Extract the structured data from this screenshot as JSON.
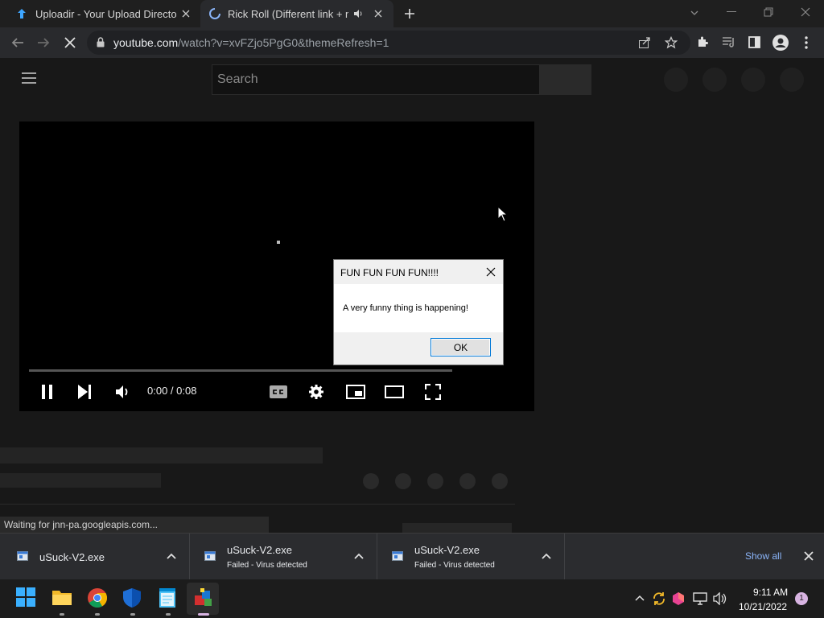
{
  "browser": {
    "tabs": [
      {
        "title": "Uploadir - Your Upload Directory",
        "icon": "upload-arrow-icon"
      },
      {
        "title": "Rick Roll (Different link + no",
        "icon": "loading-spinner-icon",
        "audio": "speaker-icon"
      }
    ],
    "url": {
      "domain": "youtube.com",
      "path": "/watch?v=xvFZjo5PgG0&themeRefresh=1"
    }
  },
  "page": {
    "search_placeholder": "Search",
    "player": {
      "time": "0:00 / 0:08"
    },
    "status_text": "Waiting for jnn-pa.googleapis.com..."
  },
  "dialog": {
    "title": "FUN FUN FUN FUN!!!!",
    "message": "A very funny thing is happening!",
    "ok_label": "OK"
  },
  "downloads": {
    "items": [
      {
        "name": "uSuck-V2.exe",
        "status": ""
      },
      {
        "name": "uSuck-V2.exe",
        "status": "Failed - Virus detected"
      },
      {
        "name": "uSuck-V2.exe",
        "status": "Failed - Virus detected"
      }
    ],
    "show_all": "Show all"
  },
  "taskbar": {
    "time": "9:11 AM",
    "date": "10/21/2022",
    "notifications": "1"
  },
  "colors": {
    "accent_blue": "#8ab4f8",
    "dialog_border": "#0078d7",
    "tab_upload_icon": "#3ea6ff"
  }
}
